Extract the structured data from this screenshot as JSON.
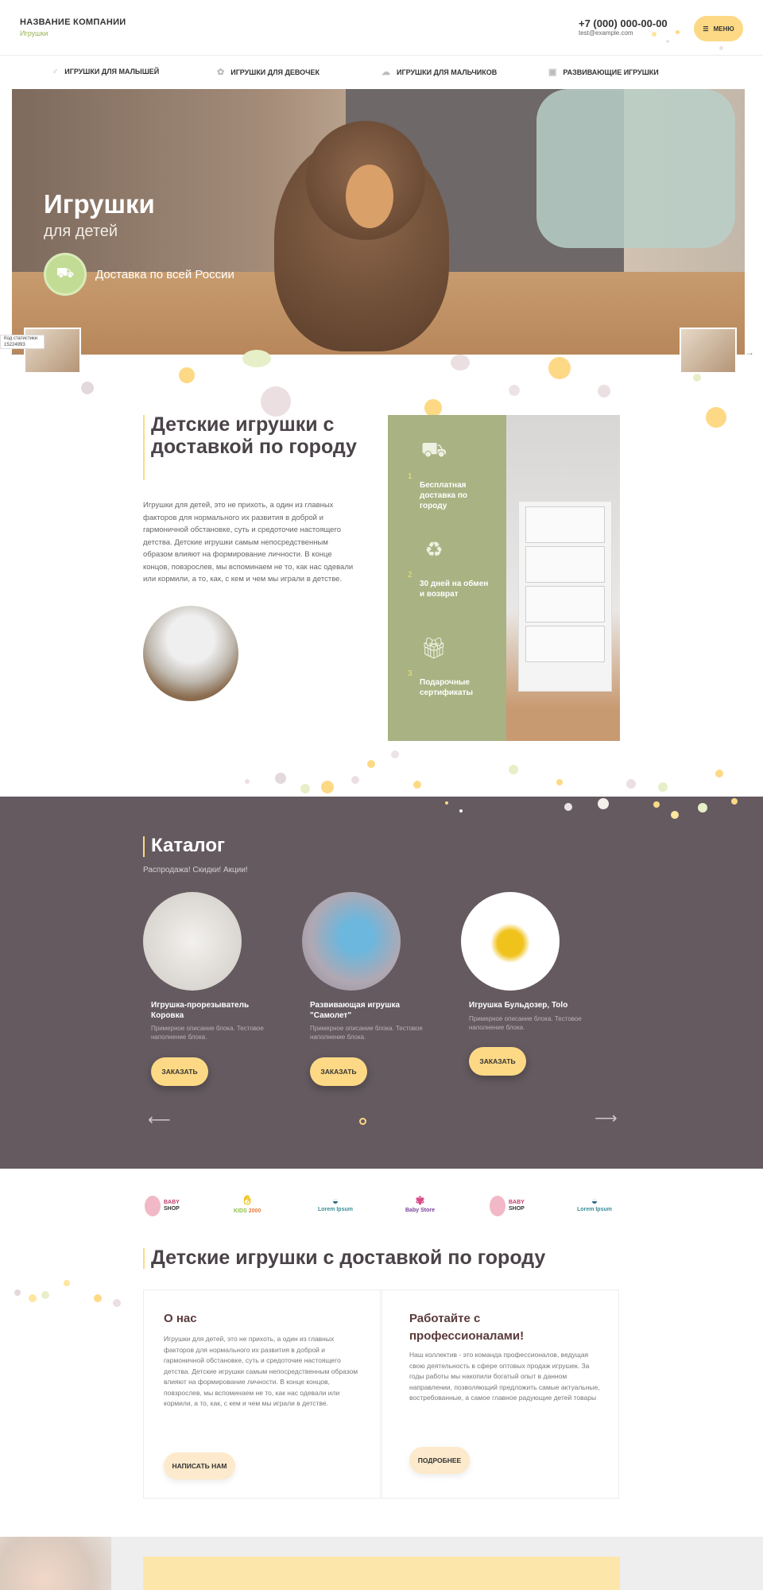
{
  "header": {
    "company": "НАЗВАНИЕ КОМПАНИИ",
    "subtitle": "Игрушки",
    "phone": "+7 (000) 000-00-00",
    "email": "test@example.com",
    "menu_label": "МЕНЮ"
  },
  "nav": {
    "items": [
      {
        "label": "ИГРУШКИ ДЛЯ МАЛЫШЕЙ",
        "icon": "rattle-icon"
      },
      {
        "label": "ИГРУШКИ ДЛЯ ДЕВОЧЕК",
        "icon": "flower-icon"
      },
      {
        "label": "ИГРУШКИ ДЛЯ МАЛЬЧИКОВ",
        "icon": "car-icon"
      },
      {
        "label": "РАЗВИВАЮЩИЕ ИГРУШКИ",
        "icon": "blocks-icon"
      }
    ]
  },
  "hero": {
    "title": "Игрушки",
    "subtitle": "для детей",
    "delivery": "Доставка по всей России",
    "tag": "Код статистики 15224993"
  },
  "about": {
    "title": "Детские игрушки с доставкой по городу",
    "text": "Игрушки для детей, это не прихоть, а один из главных факторов для нормального их развития в доброй и гармоничной обстановке, суть и средоточие настоящего детства. Детские игрушки самым непосредственным образом влияют на формирование личности. В конце концов, повзрослев, мы вспоминаем не то, как нас одевали или кормили, а то, как, с кем и чем мы играли в детстве.",
    "features": [
      {
        "num": "1",
        "text": "Бесплатная доставка по городу",
        "icon": "truck-icon"
      },
      {
        "num": "2",
        "text": "30 дней на обмен и возврат",
        "icon": "recycle-icon"
      },
      {
        "num": "3",
        "text": "Подарочные сертификаты",
        "icon": "gift-icon"
      }
    ]
  },
  "catalog": {
    "title": "Каталог",
    "subtitle": "Распродажа! Скидки! Акции!",
    "products": [
      {
        "name": "Игрушка-прорезыватель Коровка",
        "desc": "Примерное описание блока. Тестовое наполнение блока.",
        "button": "ЗАКАЗАТЬ"
      },
      {
        "name": "Развивающая игрушка \"Самолет\"",
        "desc": "Примерное описание блока. Тестовое наполнение блока.",
        "button": "ЗАКАЗАТЬ"
      },
      {
        "name": "Игрушка Бульдозер, Tolo",
        "desc": "Примерное описание блока. Тестовое наполнение блока.",
        "button": "ЗАКАЗАТЬ"
      }
    ],
    "prev": "⟵",
    "next": "⟶"
  },
  "logos": [
    {
      "line1": "BABY",
      "line2": "SHOP"
    },
    {
      "line1": "KIDS",
      "line2": "2000"
    },
    {
      "line1": "Lorem",
      "line2": "Ipsum"
    },
    {
      "line1": "Baby",
      "line2": "Store"
    },
    {
      "line1": "BABY",
      "line2": "SHOP"
    },
    {
      "line1": "Lorem",
      "line2": "Ipsum"
    }
  ],
  "info": {
    "title": "Детские игрушки с доставкой по городу",
    "left": {
      "title": "О нас",
      "text": "Игрушки для детей, это не прихоть, а один из главных факторов для нормального их развития в доброй и гармоничной обстановке, суть и средоточие настоящего детства. Детские игрушки самым непосредственным образом влияют на формирование личности. В конце концов, повзрослев, мы вспоминаем не то, как нас одевали или кормили, а то, как, с кем и чем мы играли в детстве.",
      "button": "НАПИСАТЬ НАМ"
    },
    "right": {
      "title": "Работайте с профессионалами!",
      "text": "Наш коллектив - это команда профессионалов, ведущая свою деятельность в сфере оптовых продаж игрушек. За годы работы мы накопили богатый опыт в данном направлении, позволяющий предложить самые актуальные, востребованные, а самое главное радующие детей товары",
      "button": "ПОДРОБНЕЕ"
    }
  },
  "colors": {
    "accent": "#fdd985",
    "green": "#a8b282",
    "catalog_bg": "#645a60",
    "title": "#4a4348"
  }
}
